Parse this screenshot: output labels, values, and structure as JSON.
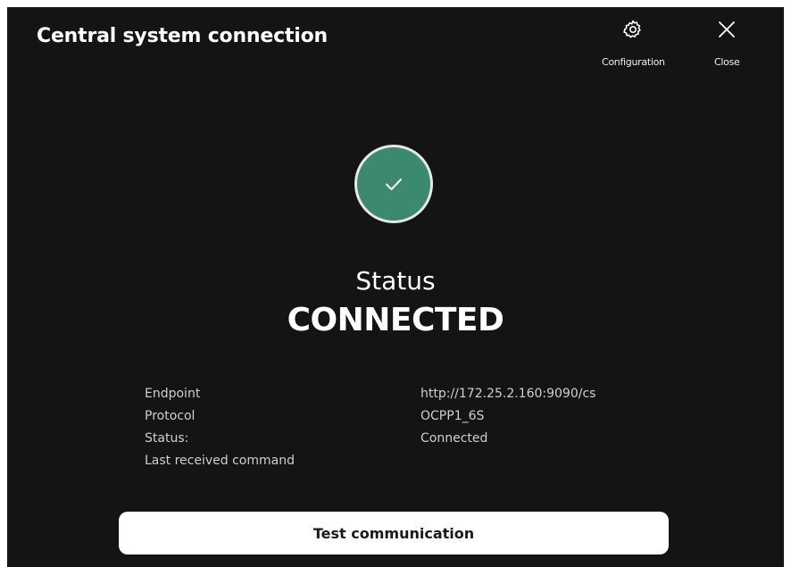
{
  "dialog": {
    "title": "Central system connection",
    "actions": {
      "configuration": {
        "label": "Configuration",
        "icon": "gear-icon"
      },
      "close": {
        "label": "Close",
        "icon": "close-icon"
      }
    }
  },
  "status": {
    "icon": "check-circle-icon",
    "color": "#3b8a6e",
    "heading": "Status",
    "value": "CONNECTED"
  },
  "details": [
    {
      "key": "Endpoint",
      "value": "http://172.25.2.160:9090/cs"
    },
    {
      "key": "Protocol",
      "value": "OCPP1_6S"
    },
    {
      "key": "Status:",
      "value": "Connected"
    },
    {
      "key": "Last received command",
      "value": ""
    }
  ],
  "footer": {
    "test_button_label": "Test communication"
  }
}
